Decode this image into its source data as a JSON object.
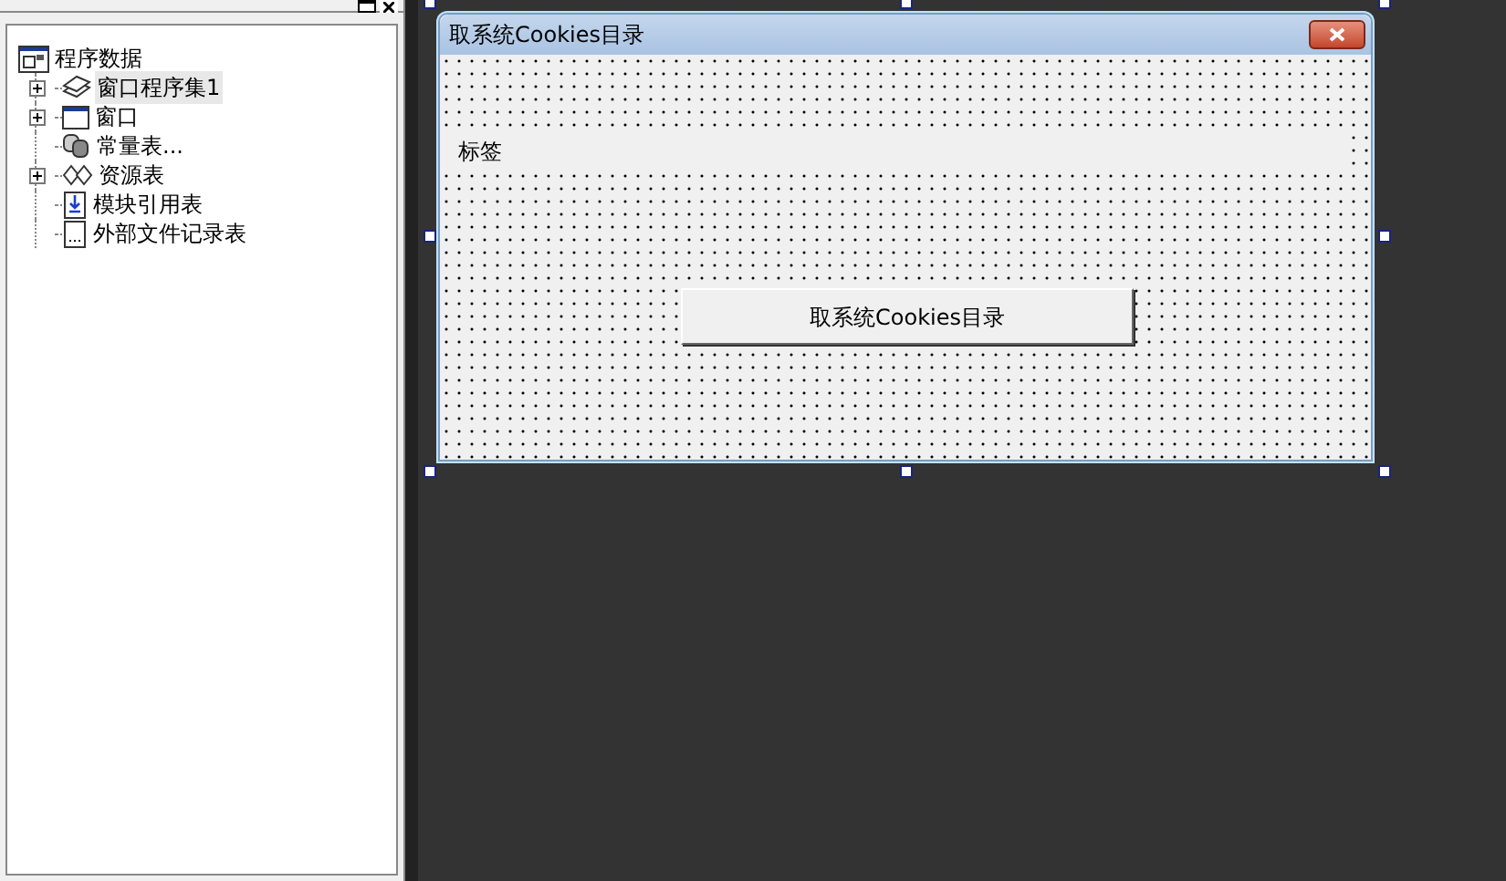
{
  "tree": {
    "label": "程序数据",
    "children": [
      {
        "label": "窗口程序集1",
        "kind": "assembly",
        "expandable": true,
        "selected": true
      },
      {
        "label": "窗口",
        "kind": "window",
        "expandable": true,
        "selected": false
      },
      {
        "label": "常量表...",
        "kind": "constants",
        "expandable": false,
        "selected": false
      },
      {
        "label": "资源表",
        "kind": "resources",
        "expandable": true,
        "selected": false
      },
      {
        "label": "模块引用表",
        "kind": "module",
        "expandable": false,
        "selected": false
      },
      {
        "label": "外部文件记录表",
        "kind": "file",
        "expandable": false,
        "selected": false
      }
    ]
  },
  "form": {
    "title": "取系统Cookies目录",
    "label": "标签",
    "button": "取系统Cookies目录"
  }
}
